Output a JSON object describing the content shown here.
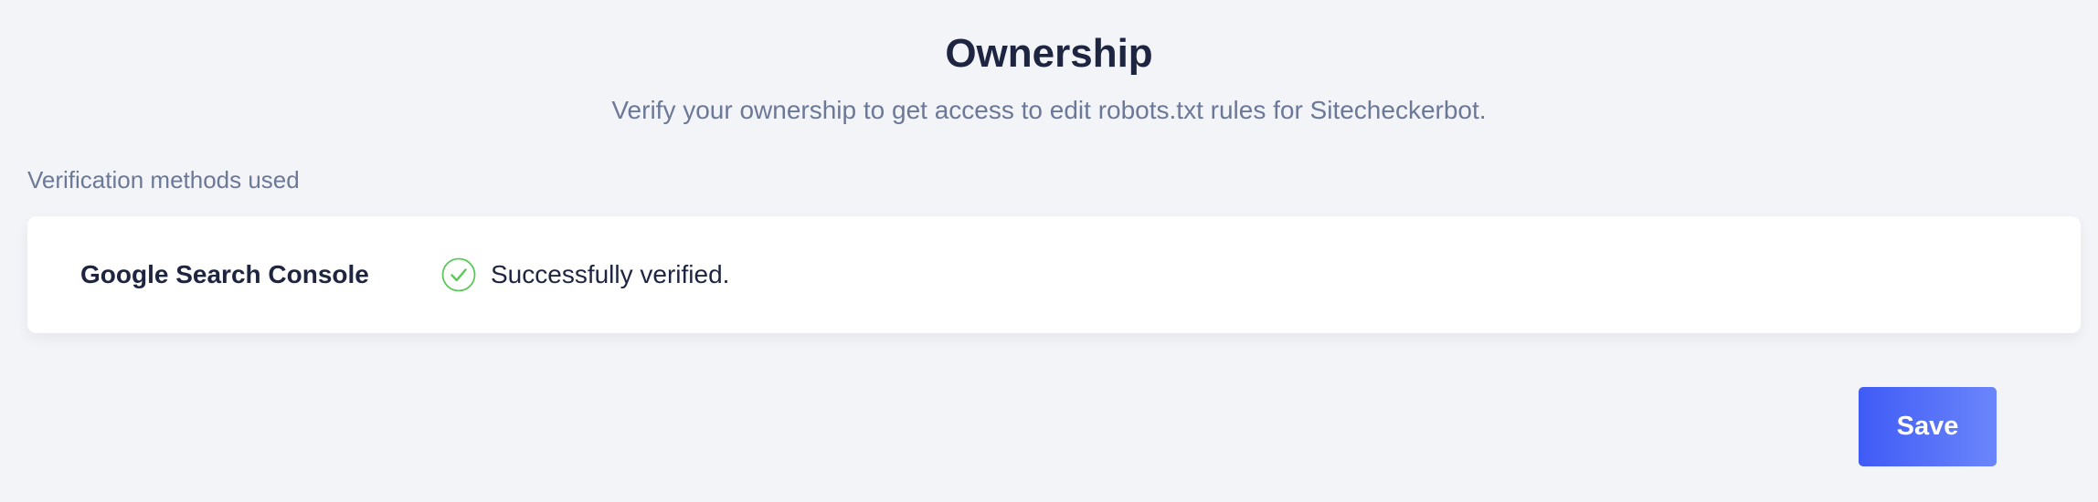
{
  "header": {
    "title": "Ownership",
    "subtitle": "Verify your ownership to get access to edit robots.txt rules for Sitecheckerbot."
  },
  "verification": {
    "section_label": "Verification methods used",
    "methods": [
      {
        "name": "Google Search Console",
        "status_icon": "check-circle-icon",
        "status_text": "Successfully verified."
      }
    ]
  },
  "actions": {
    "save_label": "Save"
  },
  "colors": {
    "background": "#f3f4f7",
    "title": "#1e2541",
    "muted": "#6b7898",
    "success": "#5cc85a",
    "accent_start": "#3f5bf6",
    "accent_end": "#6b86fa"
  }
}
